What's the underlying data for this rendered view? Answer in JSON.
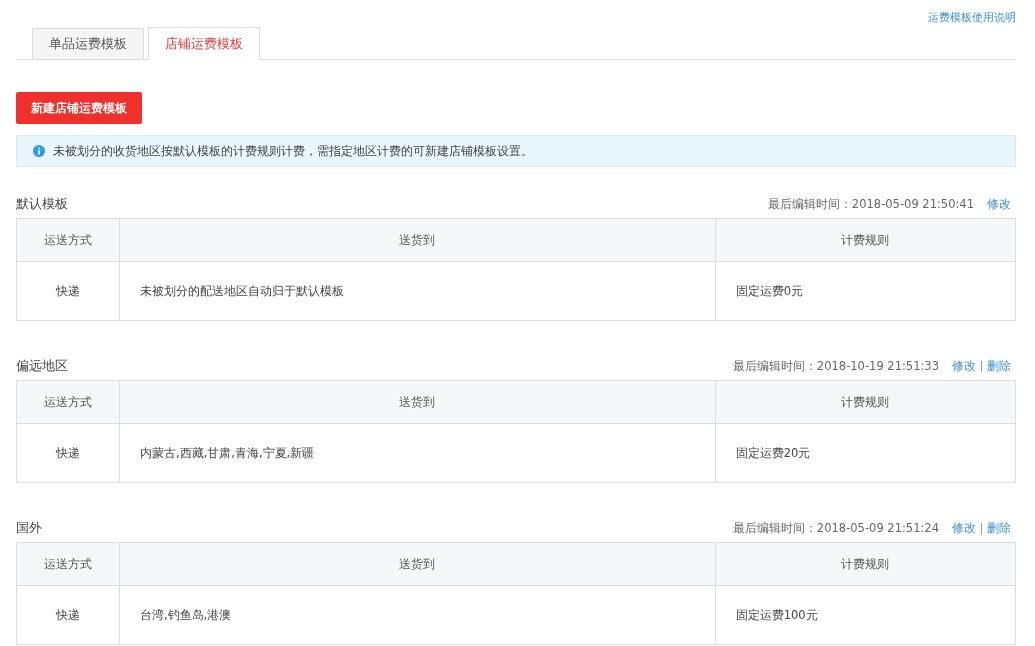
{
  "help_link": "运费模板使用说明",
  "tabs": [
    {
      "label": "单品运费模板",
      "selected": false
    },
    {
      "label": "店铺运费模板",
      "selected": true
    }
  ],
  "new_button": "新建店铺运费模板",
  "notice": "未被划分的收货地区按默认模板的计费规则计费，需指定地区计费的可新建店铺模板设置。",
  "templates": [
    {
      "name": "默认模板",
      "edited": "最后编辑时间：2018-05-09 21:50:41",
      "actions": [
        "修改"
      ],
      "columns": [
        "运送方式",
        "送货到",
        "计费规则"
      ],
      "rows": [
        [
          "快递",
          "未被划分的配送地区自动归于默认模板",
          "固定运费0元"
        ]
      ]
    },
    {
      "name": "偏远地区",
      "edited": "最后编辑时间：2018-10-19 21:51:33",
      "actions": [
        "修改",
        "删除"
      ],
      "columns": [
        "运送方式",
        "送货到",
        "计费规则"
      ],
      "rows": [
        [
          "快递",
          "内蒙古,西藏,甘肃,青海,宁夏,新疆",
          "固定运费20元"
        ]
      ]
    },
    {
      "name": "国外",
      "edited": "最后编辑时间：2018-05-09 21:51:24",
      "actions": [
        "修改",
        "删除"
      ],
      "columns": [
        "运送方式",
        "送货到",
        "计费规则"
      ],
      "rows": [
        [
          "快递",
          "台湾,钓鱼岛,港澳",
          "固定运费100元"
        ]
      ]
    }
  ]
}
